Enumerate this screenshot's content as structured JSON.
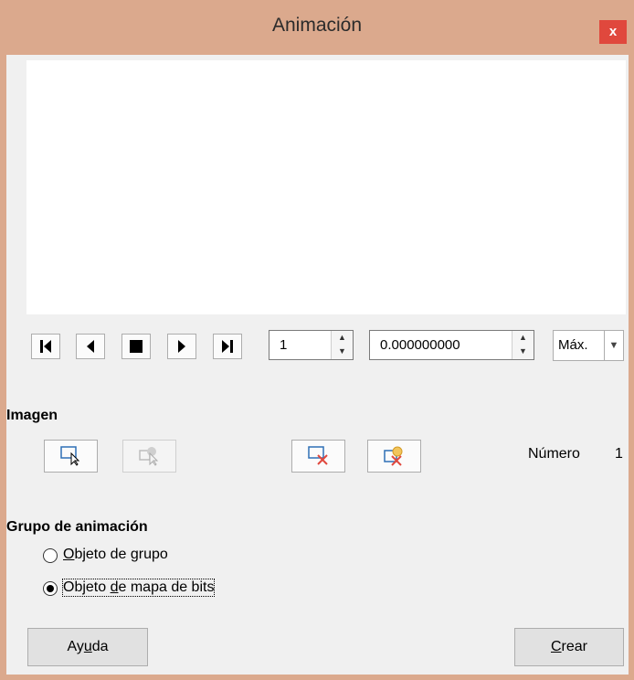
{
  "window": {
    "title": "Animación",
    "close_label": "x"
  },
  "playback": {
    "first_icon": "skip-first-icon",
    "back_icon": "play-backward-icon",
    "stop_icon": "stop-icon",
    "play_icon": "play-icon",
    "last_icon": "skip-last-icon",
    "frame_value": "1",
    "duration_value": "0.000000000",
    "loop_value": "Máx."
  },
  "image_section": {
    "heading": "Imagen",
    "apply_object_icon": "apply-object-icon",
    "apply_objects_individually_icon": "apply-objects-individually-icon",
    "delete_current_icon": "delete-current-image-icon",
    "delete_all_icon": "delete-all-images-icon",
    "number_label": "Número",
    "number_value": "1"
  },
  "animation_group": {
    "heading": "Grupo de animación",
    "options": [
      {
        "pre": "",
        "mnemonic": "O",
        "post": "bjeto de grupo",
        "checked": false
      },
      {
        "pre": "Objeto ",
        "mnemonic": "d",
        "post": "e mapa de bits",
        "checked": true
      }
    ]
  },
  "footer": {
    "help_pre": "Ay",
    "help_mnemonic": "u",
    "help_post": "da",
    "create_pre": "",
    "create_mnemonic": "C",
    "create_post": "rear"
  },
  "colors": {
    "titlebar": "#dba98d",
    "close": "#e0483d",
    "dialog_bg": "#f0f0f0",
    "delete_x": "#e0483d",
    "icon_blue": "#2e6fb6"
  }
}
